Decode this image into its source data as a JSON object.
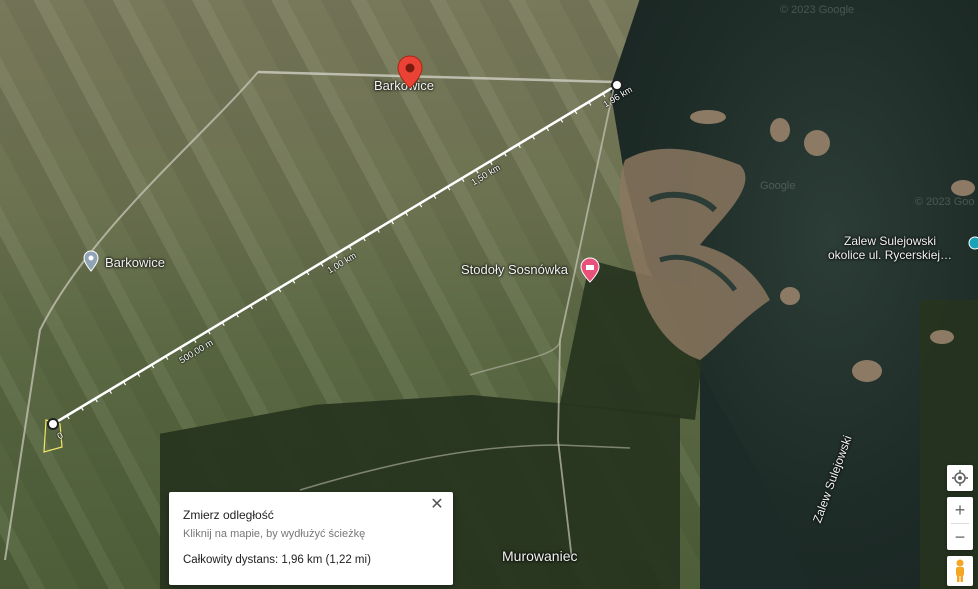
{
  "map": {
    "place_main": "Barkowice",
    "place_side": "Barkowice",
    "poi_stodoly": "Stodoły Sosnówka",
    "poi_zalew_line1": "Zalew Sulejowski",
    "poi_zalew_line2": "okolice ul. Rycerskiej…",
    "river_label": "Zalew Sulejowski",
    "place_murowaniec": "Murowaniec",
    "watermark_1": "© 2023 Google",
    "watermark_2": "Google",
    "watermark_3": "© 2023 Goo"
  },
  "measure": {
    "labels": [
      "0",
      "500,00 m",
      "1,00 km",
      "1,50 km",
      "1,96 km"
    ]
  },
  "popup": {
    "title": "Zmierz odległość",
    "hint": "Kliknij na mapie, by wydłużyć ścieżkę",
    "total": "Całkowity dystans: 1,96 km (1,22 mi)",
    "close": "✕"
  },
  "controls": {
    "zoom_in": "+",
    "zoom_out": "−"
  },
  "icons": [
    "red-pin-icon",
    "grey-pin-icon",
    "pink-camp-pin-icon",
    "teal-pin-icon",
    "location-target-icon",
    "pegman-icon"
  ]
}
